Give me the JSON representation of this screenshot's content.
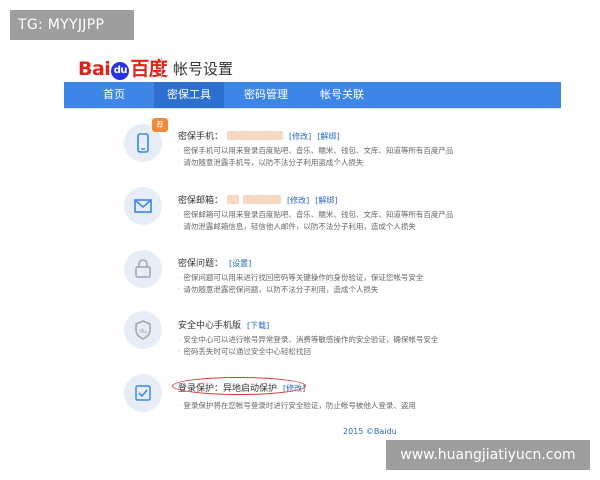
{
  "overlay_tag": "TG: MYYJJPP",
  "header": {
    "logo_bai": "Bai",
    "logo_du": "du",
    "logo_cn": "百度",
    "title": "帐号设置"
  },
  "nav": [
    "首页",
    "密保工具",
    "密码管理",
    "帐号关联"
  ],
  "rows": [
    {
      "title": "密保手机：",
      "links": [
        "[修改]",
        "[解绑]"
      ],
      "desc": [
        "密保手机可以用来登录百度贴吧、音乐、糯米、钱包、文库、知道等所有百度产品",
        "请勿随意泄露手机号，以防不法分子利用盗成个人损失"
      ],
      "badge": "荐"
    },
    {
      "title": "密保邮箱：",
      "links": [
        "[修改]",
        "[解绑]"
      ],
      "desc": [
        "密保邮箱可以用来登录百度贴吧、音乐、糯米、钱包、文库、知道等所有百度产品",
        "请勿泄露邮箱信息，轻信他人邮件，以防不法分子利用，造成个人损失"
      ]
    },
    {
      "title": "密保问题：",
      "links": [
        "[设置]"
      ],
      "desc": [
        "密保问题可以用来进行找回密码等关键操作的身份验证，保证您帐号安全",
        "请勿随意泄露密保问题，以防不法分子利用，造成个人损失"
      ]
    },
    {
      "title": "安全中心手机版",
      "links": [
        "[下载]"
      ],
      "desc": [
        "安全中心可以进行帐号异常登录、消费等敏感操作的安全验证，确保帐号安全",
        "密码丢失时可以通过安全中心轻松找回"
      ]
    },
    {
      "title": "登录保护：异地启动保护",
      "links": [
        "[修改]"
      ],
      "desc": [
        "登录保护将在您帐号登录时进行安全验证，防止帐号被他人登录、盗用"
      ]
    }
  ],
  "footer": "2015 ©Baidu",
  "watermark": "www.huangjiatiyucn.com"
}
